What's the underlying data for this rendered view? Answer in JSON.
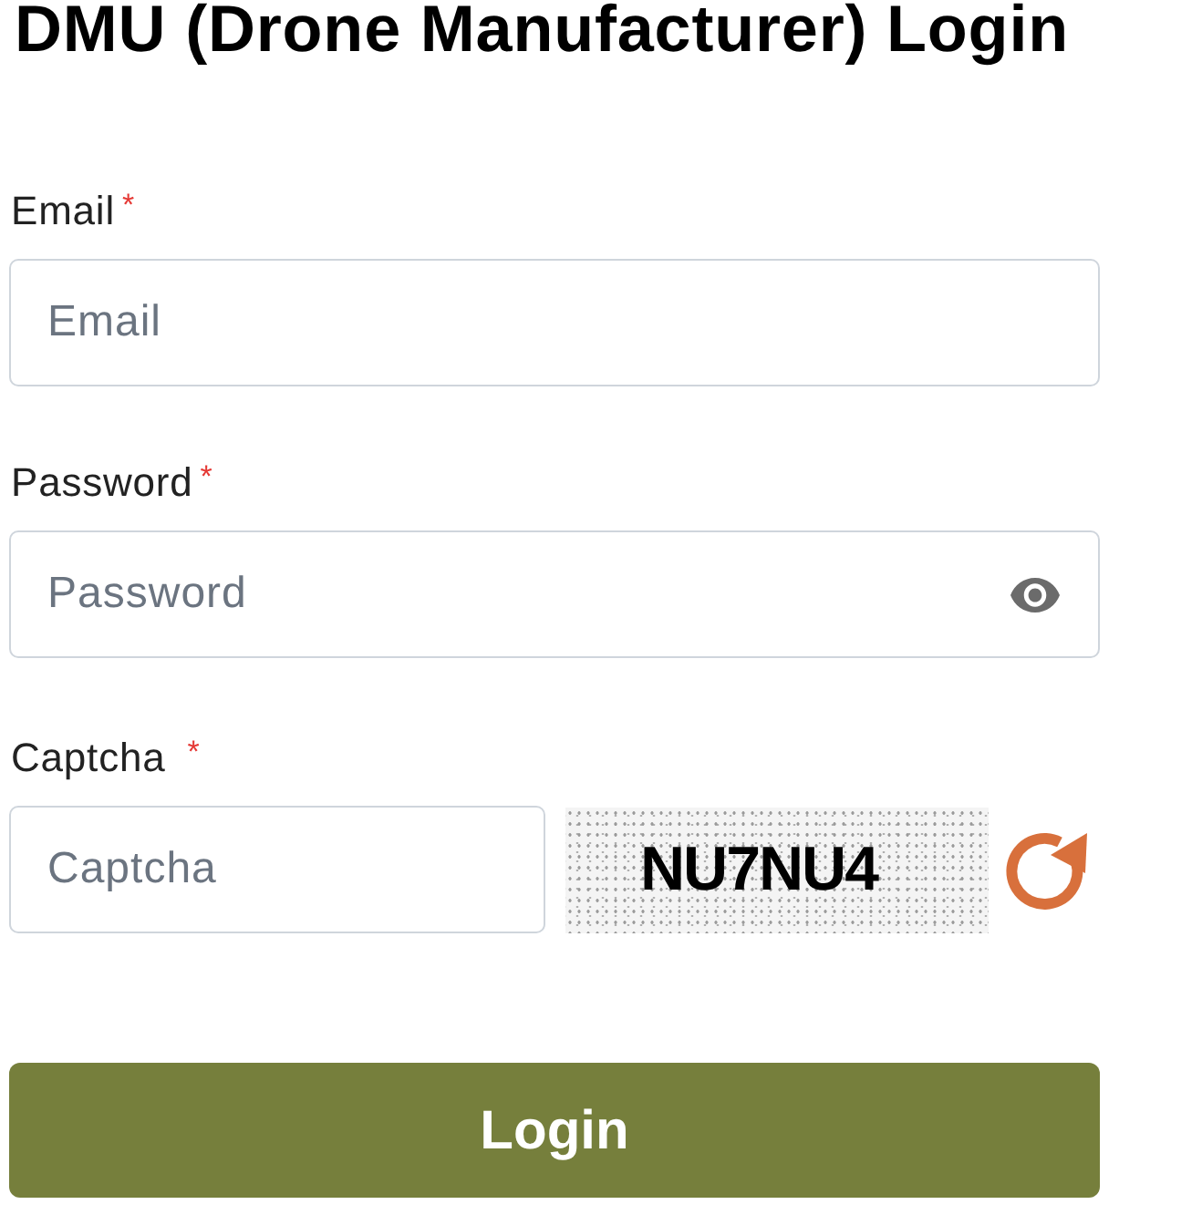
{
  "title": "DMU (Drone Manufacturer) Login",
  "fields": [
    {
      "kind": "text",
      "label": "Email",
      "required_mark": "*",
      "placeholder": "Email"
    },
    {
      "kind": "password",
      "label": "Password",
      "required_mark": "*",
      "placeholder": "Password"
    },
    {
      "kind": "captcha",
      "label": "Captcha",
      "required_mark": "*",
      "placeholder": "Captcha",
      "captcha_text": "NU7NU4"
    }
  ],
  "submit": {
    "label": "Login"
  }
}
